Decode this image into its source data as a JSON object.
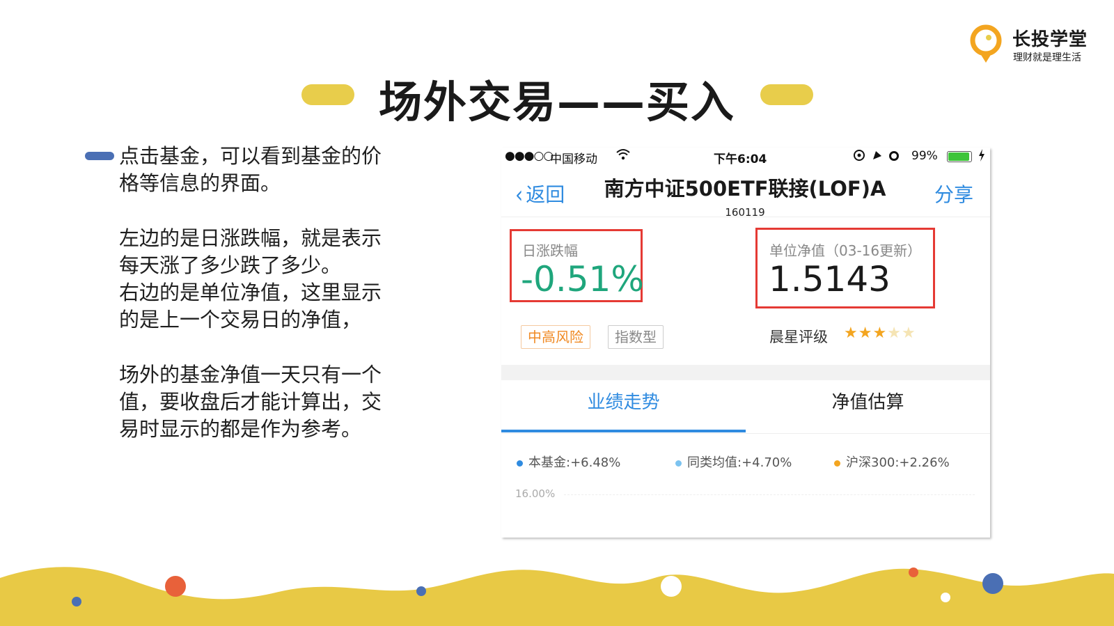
{
  "logo": {
    "title": "长投学堂",
    "subtitle": "理财就是理生活"
  },
  "slide": {
    "title": "场外交易——买入",
    "paragraphs": [
      "点击基金，可以看到基金的价格等信息的界面。",
      "左边的是日涨跌幅，就是表示每天涨了多少跌了多少。右边的是单位净值，这里显示的是上一个交易日的净值，",
      "场外的基金净值一天只有一个值，要收盘后才能计算出，交易时显示的都是作为参考。"
    ],
    "paragraph_lines": [
      [
        "点击基金，可以看到基金的价",
        "格等信息的界面。"
      ],
      [
        "左边的是日涨跌幅，就是表示",
        "每天涨了多少跌了多少。",
        "右边的是单位净值，这里显示",
        "的是上一个交易日的净值，"
      ],
      [
        "场外的基金净值一天只有一个",
        "值，要收盘后才能计算出，交",
        "易时显示的都是作为参考。"
      ]
    ]
  },
  "phone": {
    "status": {
      "signal": "●●●○○",
      "carrier": "中国移动",
      "time": "下午6:04",
      "battery_percent": "99%",
      "battery_level": 0.99
    },
    "nav": {
      "back_label": "返回",
      "title": "南方中证500ETF联接(LOF)A",
      "code": "160119",
      "share_label": "分享"
    },
    "daily_change": {
      "label": "日涨跌幅",
      "value": "-0.51%"
    },
    "nav_value": {
      "label": "单位净值（03-16更新）",
      "value": "1.5143"
    },
    "tags": [
      "中高风险",
      "指数型"
    ],
    "rating": {
      "label": "晨星评级",
      "stars": 3,
      "max_stars": 5
    },
    "tabs": [
      "业绩走势",
      "净值估算"
    ],
    "active_tab": 0,
    "legend": [
      {
        "label": "本基金:+6.48%",
        "color": "#2f8be0"
      },
      {
        "label": "同类均值:+4.70%",
        "color": "#7cc3f0"
      },
      {
        "label": "沪深300:+2.26%",
        "color": "#f3a520"
      }
    ],
    "axis_top_tick": "16.00%"
  },
  "colors": {
    "accent_blue": "#2f8be0",
    "highlight_red": "#e53a34",
    "change_green": "#1fa67c",
    "pill_yellow": "#e8cd4b",
    "wave_yellow": "#e8c945"
  }
}
